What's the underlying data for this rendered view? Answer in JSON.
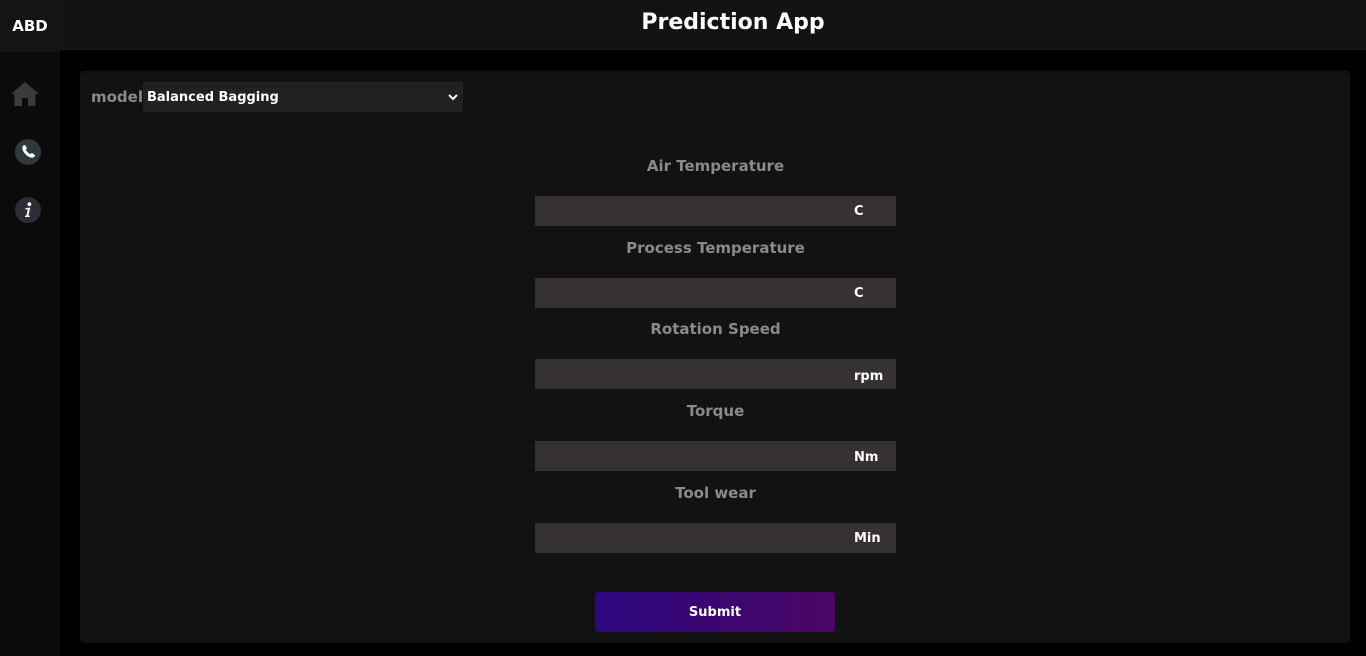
{
  "brand": "ABD",
  "header": {
    "title": "Prediction App"
  },
  "sidebar": {
    "items": [
      {
        "icon": "home-icon"
      },
      {
        "icon": "phone-icon"
      },
      {
        "icon": "info-icon"
      }
    ]
  },
  "model": {
    "label": "model",
    "selected": "Balanced Bagging"
  },
  "fields": [
    {
      "label": "Air Temperature",
      "unit": "C"
    },
    {
      "label": "Process Temperature",
      "unit": "C"
    },
    {
      "label": "Rotation Speed",
      "unit": "rpm"
    },
    {
      "label": "Torque",
      "unit": "Nm"
    },
    {
      "label": "Tool wear",
      "unit": "Min"
    }
  ],
  "submit_label": "Submit",
  "colors": {
    "background": "#000000",
    "panel": "#121212",
    "input": "#363233",
    "button_start": "#2c0880",
    "button_end": "#4b0565"
  }
}
